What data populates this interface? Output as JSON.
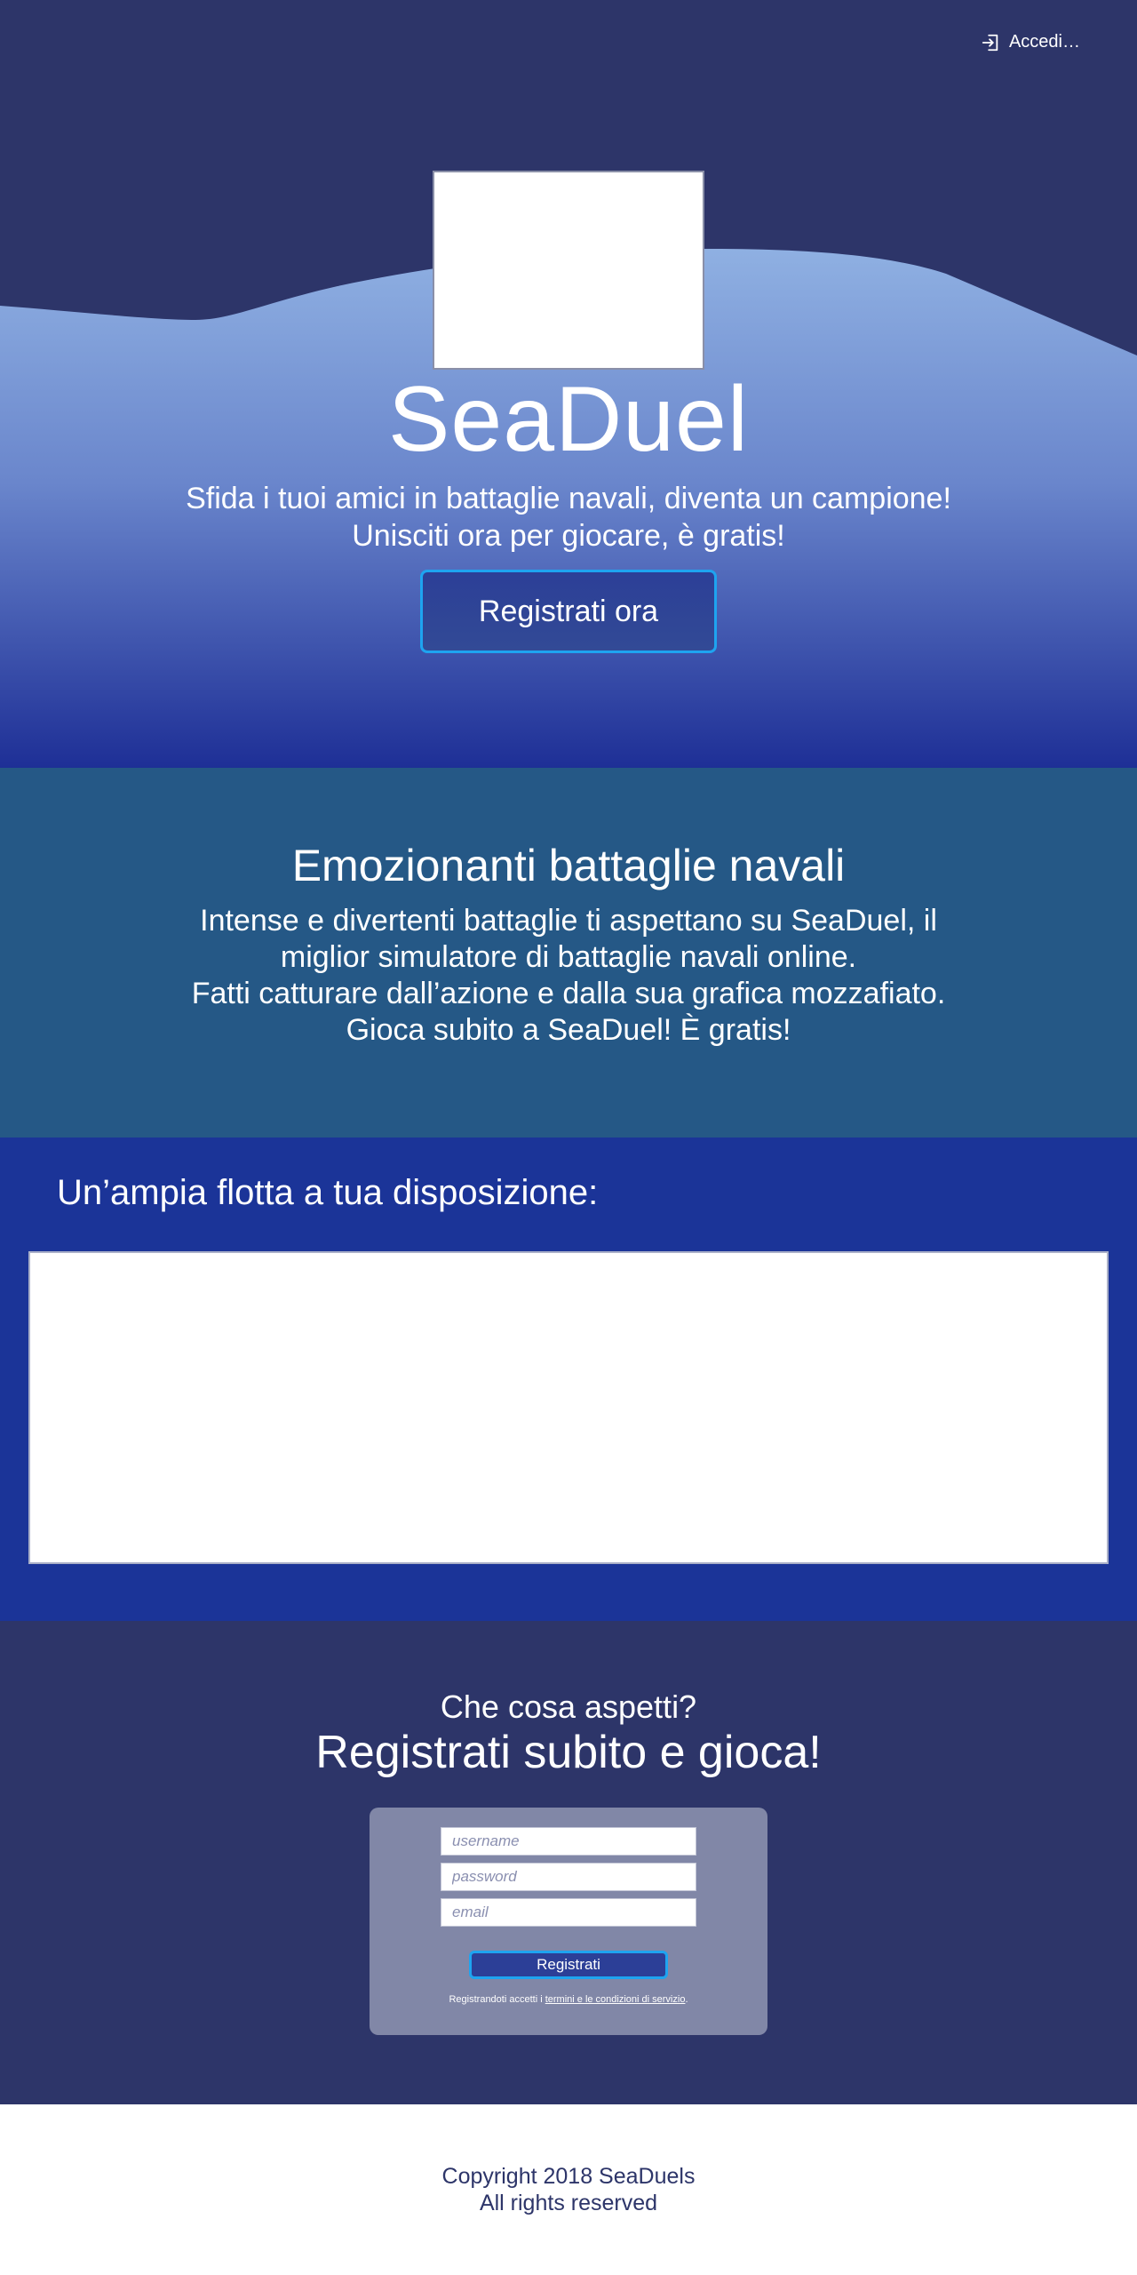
{
  "header": {
    "login_label": "Accedi…",
    "login_icon": "sign-in-icon"
  },
  "hero": {
    "title": "SeaDuel",
    "subtitle_line1": "Sfida i tuoi amici in battaglie navali, diventa un campione!",
    "subtitle_line2": "Unisciti ora per giocare, è gratis!",
    "cta_label": "Registrati ora"
  },
  "battles": {
    "heading": "Emozionanti battaglie navali",
    "line1": "Intense e divertenti battaglie ti aspettano su SeaDuel, il",
    "line2": "miglior simulatore di battaglie navali online.",
    "line3": "Fatti catturare dall’azione e dalla sua grafica mozzafiato.",
    "line4": "Gioca subito a SeaDuel! È gratis!"
  },
  "fleet": {
    "heading": "Un’ampia flotta a tua disposizione:"
  },
  "signup": {
    "eyebrow": "Che cosa aspetti?",
    "heading": "Registrati subito e gioca!",
    "username_placeholder": "username",
    "password_placeholder": "password",
    "email_placeholder": "email",
    "submit_label": "Registrati",
    "terms_prefix": "Registrandoti accetti i ",
    "terms_link": "termini e le condizioni di servizio",
    "terms_suffix": "."
  },
  "footer": {
    "copyright": "Copyright 2018 SeaDuels",
    "rights": "All rights reserved"
  },
  "colors": {
    "navy": "#2d3569",
    "ocean_light": "#8fb0e2",
    "ocean_deep": "#1e2f96",
    "battles_bg": "#255886",
    "fleet_bg": "#1b3498",
    "accent_border": "#1ea4f0",
    "form_card": "#8187a7"
  }
}
